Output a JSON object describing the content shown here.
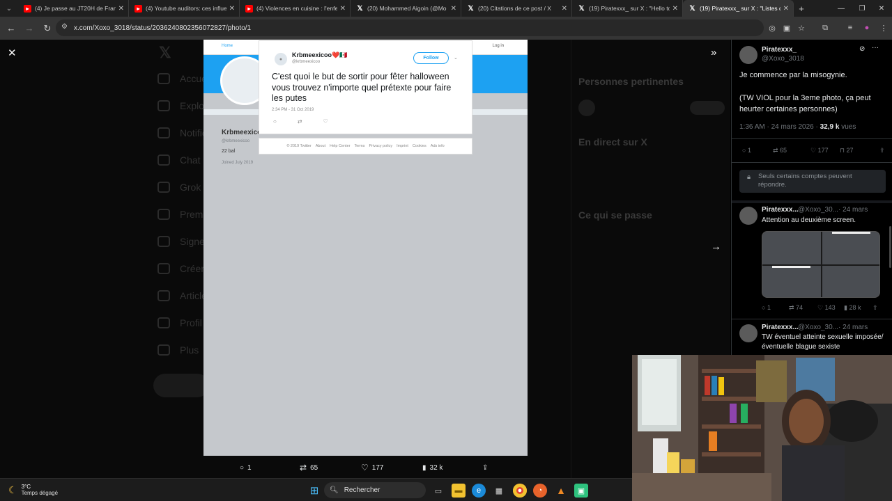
{
  "browser": {
    "tabs": [
      {
        "title": "(4) Je passe au JT20H de France",
        "icon": "youtube-icon",
        "active": false
      },
      {
        "title": "(4) Youtube auditors: ces influe",
        "icon": "youtube-icon",
        "active": false
      },
      {
        "title": "(4) Violences en cuisine : l'enfe",
        "icon": "youtube-icon",
        "active": false
      },
      {
        "title": "(20) Mohammed Aigoin (@Mo",
        "icon": "x-icon",
        "active": false
      },
      {
        "title": "(20) Citations de ce post / X",
        "icon": "x-icon",
        "active": false
      },
      {
        "title": "(19) Piratexxx_ sur X : \"Hello to",
        "icon": "x-icon",
        "active": false
      },
      {
        "title": "(19) Piratexxx_ sur X : \"Listes de",
        "icon": "x-icon",
        "active": true
      }
    ],
    "url": "x.com/Xoxo_3018/status/2036240802356072827/photo/1"
  },
  "embedded_tweet": {
    "page_nav_left": "Home",
    "page_nav_right": "Log in",
    "profile_name": "Krbmeexicoo",
    "profile_handle": "@krbmeexicoo",
    "profile_bio": "22 bal",
    "profile_joined": "Joined July 2019",
    "author_name": "Krbmeexicoo❤️🇲🇽",
    "author_handle": "@krbmeexicoo",
    "follow_label": "Follow",
    "text": "C'est quoi le but de sortir pour fêter halloween vous trouvez n'importe quel prétexte pour faire les putes",
    "timestamp": "2:34 PM - 31 Oct 2019",
    "footer_links": [
      "© 2019 Twitter",
      "About",
      "Help Center",
      "Terms",
      "Privacy policy",
      "Imprint",
      "Cookies",
      "Ads info"
    ]
  },
  "media_actions": {
    "replies": "1",
    "reposts": "65",
    "likes": "177",
    "views": "32 k"
  },
  "post": {
    "author_name": "Piratexxx_",
    "author_handle": "@Xoxo_3018",
    "text_line1": "Je commence par la misogynie.",
    "text_line2": "(TW VIOL pour la 3eme photo, ça peut heurter certaines personnes)",
    "time": "1:36 AM · 24 mars 2026 ·",
    "views_count": "32,9 k",
    "views_label": "vues",
    "replies": "1",
    "reposts": "65",
    "likes": "177",
    "bookmarks": "27",
    "reply_restriction": "Seuls certains comptes peuvent répondre."
  },
  "replies": [
    {
      "name": "Piratexxx...",
      "handle": "@Xoxo_30...",
      "date": "· 24 mars",
      "text": "Attention au deuxième screen.",
      "replies": "1",
      "reposts": "74",
      "likes": "143",
      "views": "28 k"
    },
    {
      "name": "Piratexxx...",
      "handle": "@Xoxo_30...",
      "date": "· 24 mars",
      "text": "TW éventuel atteinte sexuelle imposée/ éventuelle blague sexiste"
    }
  ],
  "background_sidebar": [
    "Accueil",
    "Explorer",
    "Notifications",
    "Chat",
    "Grok",
    "Premium",
    "Signets",
    "Créer",
    "Articles",
    "Profil",
    "Plus"
  ],
  "background_right": {
    "h1": "Personnes pertinentes",
    "h2": "En direct sur X",
    "h3": "Ce qui se passe"
  },
  "taskbar": {
    "temp": "3°C",
    "weather": "Temps dégagé",
    "search_placeholder": "Rechercher"
  }
}
